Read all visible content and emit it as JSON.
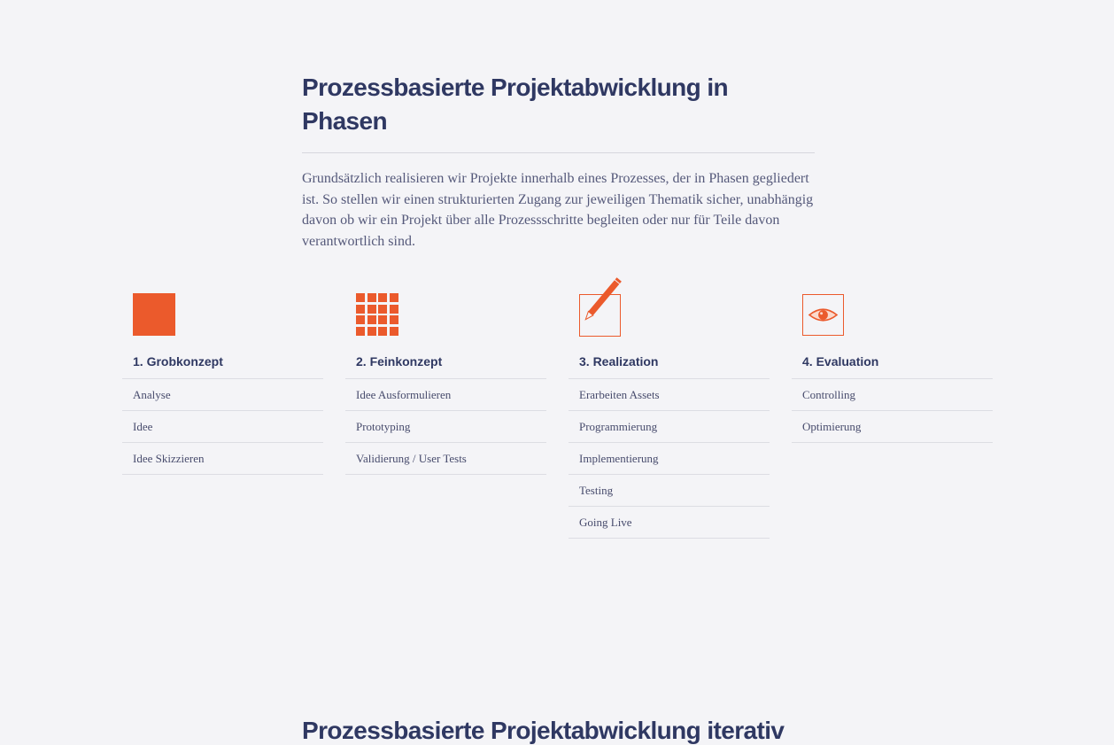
{
  "intro": {
    "title": "Prozessbasierte Projektabwicklung in Phasen",
    "text": "Grundsätzlich realisieren wir Projekte innerhalb eines Prozesses, der in Phasen gegliedert ist. So stellen wir einen strukturierten Zugang zur jeweiligen Thematik sicher, unabhängig davon ob wir ein Projekt über alle Prozessschritte begleiten oder nur für Teile davon verantwortlich sind."
  },
  "accent_color": "#eb5a2c",
  "phases": [
    {
      "title": "1. Grobkonzept",
      "icon": "solid-square-icon",
      "steps": [
        "Analyse",
        "Idee",
        "Idee Skizzieren"
      ]
    },
    {
      "title": "2. Feinkonzept",
      "icon": "grid-icon",
      "steps": [
        "Idee Ausformulieren",
        "Prototyping",
        "Validierung / User Tests"
      ]
    },
    {
      "title": "3. Realization",
      "icon": "pencil-icon",
      "steps": [
        "Erarbeiten Assets",
        "Programmierung",
        "Implementierung",
        "Testing",
        "Going Live"
      ]
    },
    {
      "title": "4. Evaluation",
      "icon": "eye-icon",
      "steps": [
        "Controlling",
        "Optimierung"
      ]
    }
  ],
  "next_section": {
    "title": "Prozessbasierte Projektabwicklung iterativ"
  }
}
